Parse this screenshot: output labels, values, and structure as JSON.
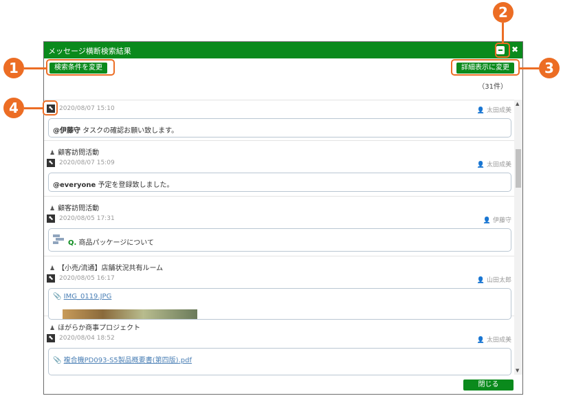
{
  "window": {
    "title": "メッセージ横断検索結果",
    "minimize_glyph": "−",
    "close_glyph": "✖",
    "search_condition_button": "検索条件を変更",
    "detail_view_button": "詳細表示に変更",
    "count": "（31件）",
    "close_button": "閉じる"
  },
  "messages": [
    {
      "room": "",
      "date": "2020/08/07 15:10",
      "user": "太田成美",
      "mention": "@伊藤守",
      "text": " タスクの確認お願い致します。"
    },
    {
      "room": "顧客訪問活動",
      "date": "2020/08/07 15:09",
      "user": "太田成美",
      "mention": "@everyone",
      "text": " 予定を登録致しました。"
    },
    {
      "room": "顧客訪問活動",
      "date": "2020/08/05 17:31",
      "user": "伊藤守",
      "task_label": "Q.",
      "text": "商品パッケージについて"
    },
    {
      "room": "【小売/流通】店舗状況共有ルーム",
      "date": "2020/08/05 16:17",
      "user": "山田太郎",
      "file": "IMG_0119.JPG"
    },
    {
      "room": "ほがらか商事プロジェクト",
      "date": "2020/08/04 18:52",
      "user": "太田成美",
      "file": "複合機PD093-S5製品概要書(第四版).pdf"
    }
  ],
  "callouts": [
    "1",
    "2",
    "3",
    "4"
  ],
  "icons": {
    "room": "people-icon",
    "jump": "jump-arrow-icon",
    "user": "person-icon",
    "attach": "paperclip-icon",
    "task": "task-icon"
  },
  "colors": {
    "accent": "#0a8a1c",
    "callout": "#ec6d24"
  }
}
